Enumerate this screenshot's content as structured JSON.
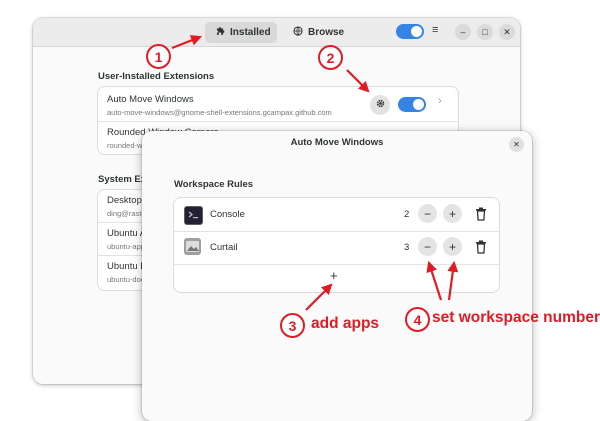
{
  "main_window": {
    "tabs": [
      {
        "label": "Installed",
        "icon": "puzzle-icon",
        "active": true
      },
      {
        "label": "Browse",
        "icon": "globe-icon",
        "active": false
      }
    ],
    "menu_glyph": "≡",
    "minimize_glyph": "–",
    "maximize_glyph": "□",
    "close_glyph": "✕",
    "user_section_title": "User-Installed Extensions",
    "user_extensions": [
      {
        "name": "Auto Move Windows",
        "id": "auto-move-windows@gnome-shell-extensions.gcampax.github.com",
        "enabled": true
      },
      {
        "name": "Rounded Window Corners",
        "id": "rounded-window-corners",
        "enabled": true
      }
    ],
    "system_section_title": "System Extensions",
    "system_extensions": [
      {
        "name": "Desktop Icons",
        "id": "ding@rastersoft.com"
      },
      {
        "name": "Ubuntu AppIndicators",
        "id": "ubuntu-appindicators@ubuntu.com"
      },
      {
        "name": "Ubuntu Dock",
        "id": "ubuntu-dock@ubuntu.com"
      }
    ]
  },
  "dialog": {
    "title": "Auto Move Windows",
    "close_glyph": "✕",
    "section_title": "Workspace Rules",
    "rules": [
      {
        "app": "Console",
        "workspace": 2,
        "icon": "terminal-icon"
      },
      {
        "app": "Curtail",
        "workspace": 3,
        "icon": "image-compress-icon"
      }
    ],
    "minus_glyph": "−",
    "plus_glyph": "+",
    "add_glyph": "+"
  },
  "annotations": {
    "step1": "1",
    "step2": "2",
    "step3": "3",
    "step4": "4",
    "label3": "add apps",
    "label4": "set workspace number",
    "color": "#e01b24"
  },
  "colors": {
    "accent": "#3584e4",
    "annotation": "#e01b24"
  }
}
